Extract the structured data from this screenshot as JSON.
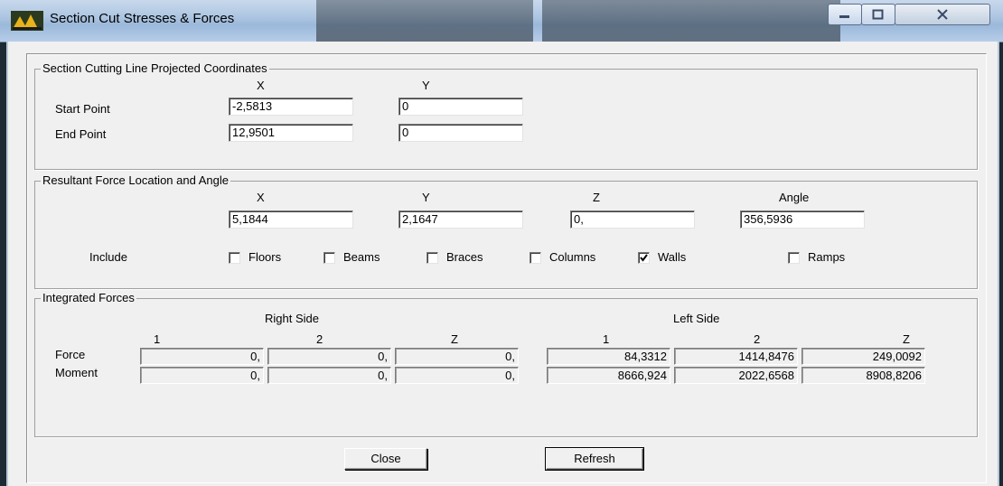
{
  "window": {
    "title": "Section Cut Stresses & Forces",
    "icon": "app-logo-icon",
    "controls": [
      "minimize-icon",
      "maximize-icon",
      "close-icon"
    ]
  },
  "section_line": {
    "legend": "Section Cutting Line Projected Coordinates",
    "col_x": "X",
    "col_y": "Y",
    "start_label": "Start Point",
    "end_label": "End Point",
    "start_x": "-2,5813",
    "start_y": "0",
    "end_x": "12,9501",
    "end_y": "0"
  },
  "resultant": {
    "legend": "Resultant Force Location and Angle",
    "col_x": "X",
    "col_y": "Y",
    "col_z": "Z",
    "col_angle": "Angle",
    "x": "5,1844",
    "y": "2,1647",
    "z": "0,",
    "angle": "356,5936",
    "include_label": "Include",
    "include": [
      {
        "label": "Floors",
        "checked": false
      },
      {
        "label": "Beams",
        "checked": false
      },
      {
        "label": "Braces",
        "checked": false
      },
      {
        "label": "Columns",
        "checked": false
      },
      {
        "label": "Walls",
        "checked": true
      },
      {
        "label": "Ramps",
        "checked": false
      }
    ]
  },
  "integrated": {
    "legend": "Integrated Forces",
    "right_side": "Right Side",
    "left_side": "Left Side",
    "cols": [
      "1",
      "2",
      "Z",
      "1",
      "2",
      "Z"
    ],
    "force_label": "Force",
    "moment_label": "Moment",
    "force": [
      "0,",
      "0,",
      "0,",
      "84,3312",
      "1414,8476",
      "249,0092"
    ],
    "moment": [
      "0,",
      "0,",
      "0,",
      "8666,924",
      "2022,6568",
      "8908,8206"
    ]
  },
  "buttons": {
    "close": "Close",
    "refresh": "Refresh"
  }
}
